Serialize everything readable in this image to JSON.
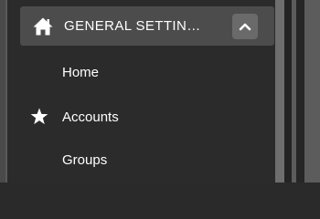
{
  "header": {
    "title": "GENERAL SETTIN…",
    "icon": "home-icon",
    "toggle_icon": "chevron-up-icon"
  },
  "menu": {
    "items": [
      {
        "label": "Home",
        "icon": ""
      },
      {
        "label": "Accounts",
        "icon": "star-icon"
      },
      {
        "label": "Groups",
        "icon": ""
      }
    ]
  },
  "colors": {
    "panel_bg": "#2b2b2b",
    "header_bg": "#4c4c4c",
    "toggle_bg": "#6a6a6a",
    "text": "#ffffff",
    "scrollbar": "#6e6e6e"
  }
}
